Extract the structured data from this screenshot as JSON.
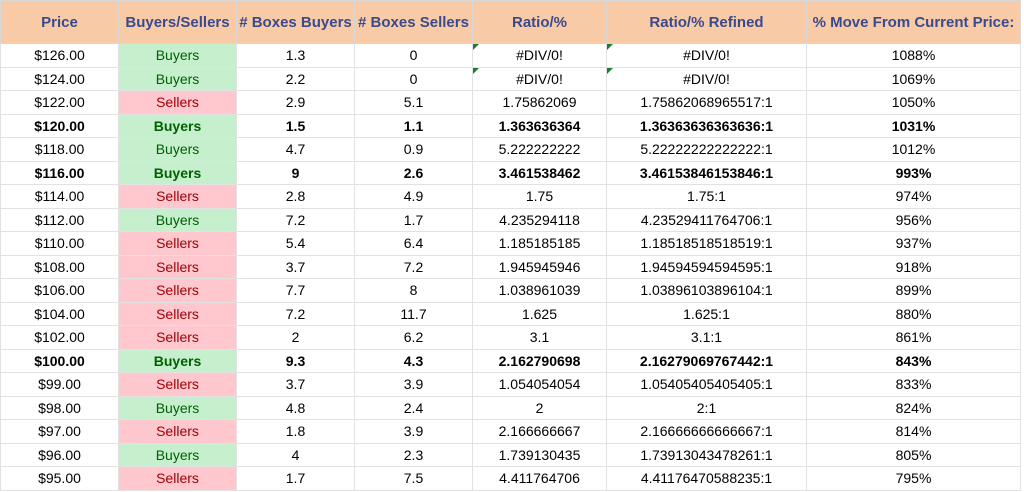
{
  "sheet": {
    "headers": [
      "Price",
      "Buyers/Sellers",
      "# Boxes Buyers",
      "# Boxes Sellers",
      "Ratio/%",
      "Ratio/% Refined",
      "% Move From Current Price:"
    ],
    "rows": [
      {
        "price": "$126.00",
        "side": "Buyers",
        "boxes_buyers": "1.3",
        "boxes_sellers": "0",
        "ratio": "#DIV/0!",
        "ratio_refined": "#DIV/0!",
        "move": "1088%",
        "bold": false,
        "flag": true
      },
      {
        "price": "$124.00",
        "side": "Buyers",
        "boxes_buyers": "2.2",
        "boxes_sellers": "0",
        "ratio": "#DIV/0!",
        "ratio_refined": "#DIV/0!",
        "move": "1069%",
        "bold": false,
        "flag": true
      },
      {
        "price": "$122.00",
        "side": "Sellers",
        "boxes_buyers": "2.9",
        "boxes_sellers": "5.1",
        "ratio": "1.75862069",
        "ratio_refined": "1.75862068965517:1",
        "move": "1050%",
        "bold": false,
        "flag": false
      },
      {
        "price": "$120.00",
        "side": "Buyers",
        "boxes_buyers": "1.5",
        "boxes_sellers": "1.1",
        "ratio": "1.363636364",
        "ratio_refined": "1.36363636363636:1",
        "move": "1031%",
        "bold": true,
        "flag": false
      },
      {
        "price": "$118.00",
        "side": "Buyers",
        "boxes_buyers": "4.7",
        "boxes_sellers": "0.9",
        "ratio": "5.222222222",
        "ratio_refined": "5.22222222222222:1",
        "move": "1012%",
        "bold": false,
        "flag": false
      },
      {
        "price": "$116.00",
        "side": "Buyers",
        "boxes_buyers": "9",
        "boxes_sellers": "2.6",
        "ratio": "3.461538462",
        "ratio_refined": "3.46153846153846:1",
        "move": "993%",
        "bold": true,
        "flag": false
      },
      {
        "price": "$114.00",
        "side": "Sellers",
        "boxes_buyers": "2.8",
        "boxes_sellers": "4.9",
        "ratio": "1.75",
        "ratio_refined": "1.75:1",
        "move": "974%",
        "bold": false,
        "flag": false
      },
      {
        "price": "$112.00",
        "side": "Buyers",
        "boxes_buyers": "7.2",
        "boxes_sellers": "1.7",
        "ratio": "4.235294118",
        "ratio_refined": "4.23529411764706:1",
        "move": "956%",
        "bold": false,
        "flag": false
      },
      {
        "price": "$110.00",
        "side": "Sellers",
        "boxes_buyers": "5.4",
        "boxes_sellers": "6.4",
        "ratio": "1.185185185",
        "ratio_refined": "1.18518518518519:1",
        "move": "937%",
        "bold": false,
        "flag": false
      },
      {
        "price": "$108.00",
        "side": "Sellers",
        "boxes_buyers": "3.7",
        "boxes_sellers": "7.2",
        "ratio": "1.945945946",
        "ratio_refined": "1.94594594594595:1",
        "move": "918%",
        "bold": false,
        "flag": false
      },
      {
        "price": "$106.00",
        "side": "Sellers",
        "boxes_buyers": "7.7",
        "boxes_sellers": "8",
        "ratio": "1.038961039",
        "ratio_refined": "1.03896103896104:1",
        "move": "899%",
        "bold": false,
        "flag": false
      },
      {
        "price": "$104.00",
        "side": "Sellers",
        "boxes_buyers": "7.2",
        "boxes_sellers": "11.7",
        "ratio": "1.625",
        "ratio_refined": "1.625:1",
        "move": "880%",
        "bold": false,
        "flag": false
      },
      {
        "price": "$102.00",
        "side": "Sellers",
        "boxes_buyers": "2",
        "boxes_sellers": "6.2",
        "ratio": "3.1",
        "ratio_refined": "3.1:1",
        "move": "861%",
        "bold": false,
        "flag": false
      },
      {
        "price": "$100.00",
        "side": "Buyers",
        "boxes_buyers": "9.3",
        "boxes_sellers": "4.3",
        "ratio": "2.162790698",
        "ratio_refined": "2.16279069767442:1",
        "move": "843%",
        "bold": true,
        "flag": false
      },
      {
        "price": "$99.00",
        "side": "Sellers",
        "boxes_buyers": "3.7",
        "boxes_sellers": "3.9",
        "ratio": "1.054054054",
        "ratio_refined": "1.05405405405405:1",
        "move": "833%",
        "bold": false,
        "flag": false
      },
      {
        "price": "$98.00",
        "side": "Buyers",
        "boxes_buyers": "4.8",
        "boxes_sellers": "2.4",
        "ratio": "2",
        "ratio_refined": "2:1",
        "move": "824%",
        "bold": false,
        "flag": false
      },
      {
        "price": "$97.00",
        "side": "Sellers",
        "boxes_buyers": "1.8",
        "boxes_sellers": "3.9",
        "ratio": "2.166666667",
        "ratio_refined": "2.16666666666667:1",
        "move": "814%",
        "bold": false,
        "flag": false
      },
      {
        "price": "$96.00",
        "side": "Buyers",
        "boxes_buyers": "4",
        "boxes_sellers": "2.3",
        "ratio": "1.739130435",
        "ratio_refined": "1.73913043478261:1",
        "move": "805%",
        "bold": false,
        "flag": false
      },
      {
        "price": "$95.00",
        "side": "Sellers",
        "boxes_buyers": "1.7",
        "boxes_sellers": "7.5",
        "ratio": "4.411764706",
        "ratio_refined": "4.41176470588235:1",
        "move": "795%",
        "bold": false,
        "flag": false
      }
    ]
  },
  "colors": {
    "header_bg": "#f8cba6",
    "header_text": "#3a4a8c",
    "buyers_bg": "#c6efce",
    "buyers_text": "#006100",
    "sellers_bg": "#ffc7ce",
    "sellers_text": "#9c0006",
    "error_flag": "#1e7a32"
  }
}
